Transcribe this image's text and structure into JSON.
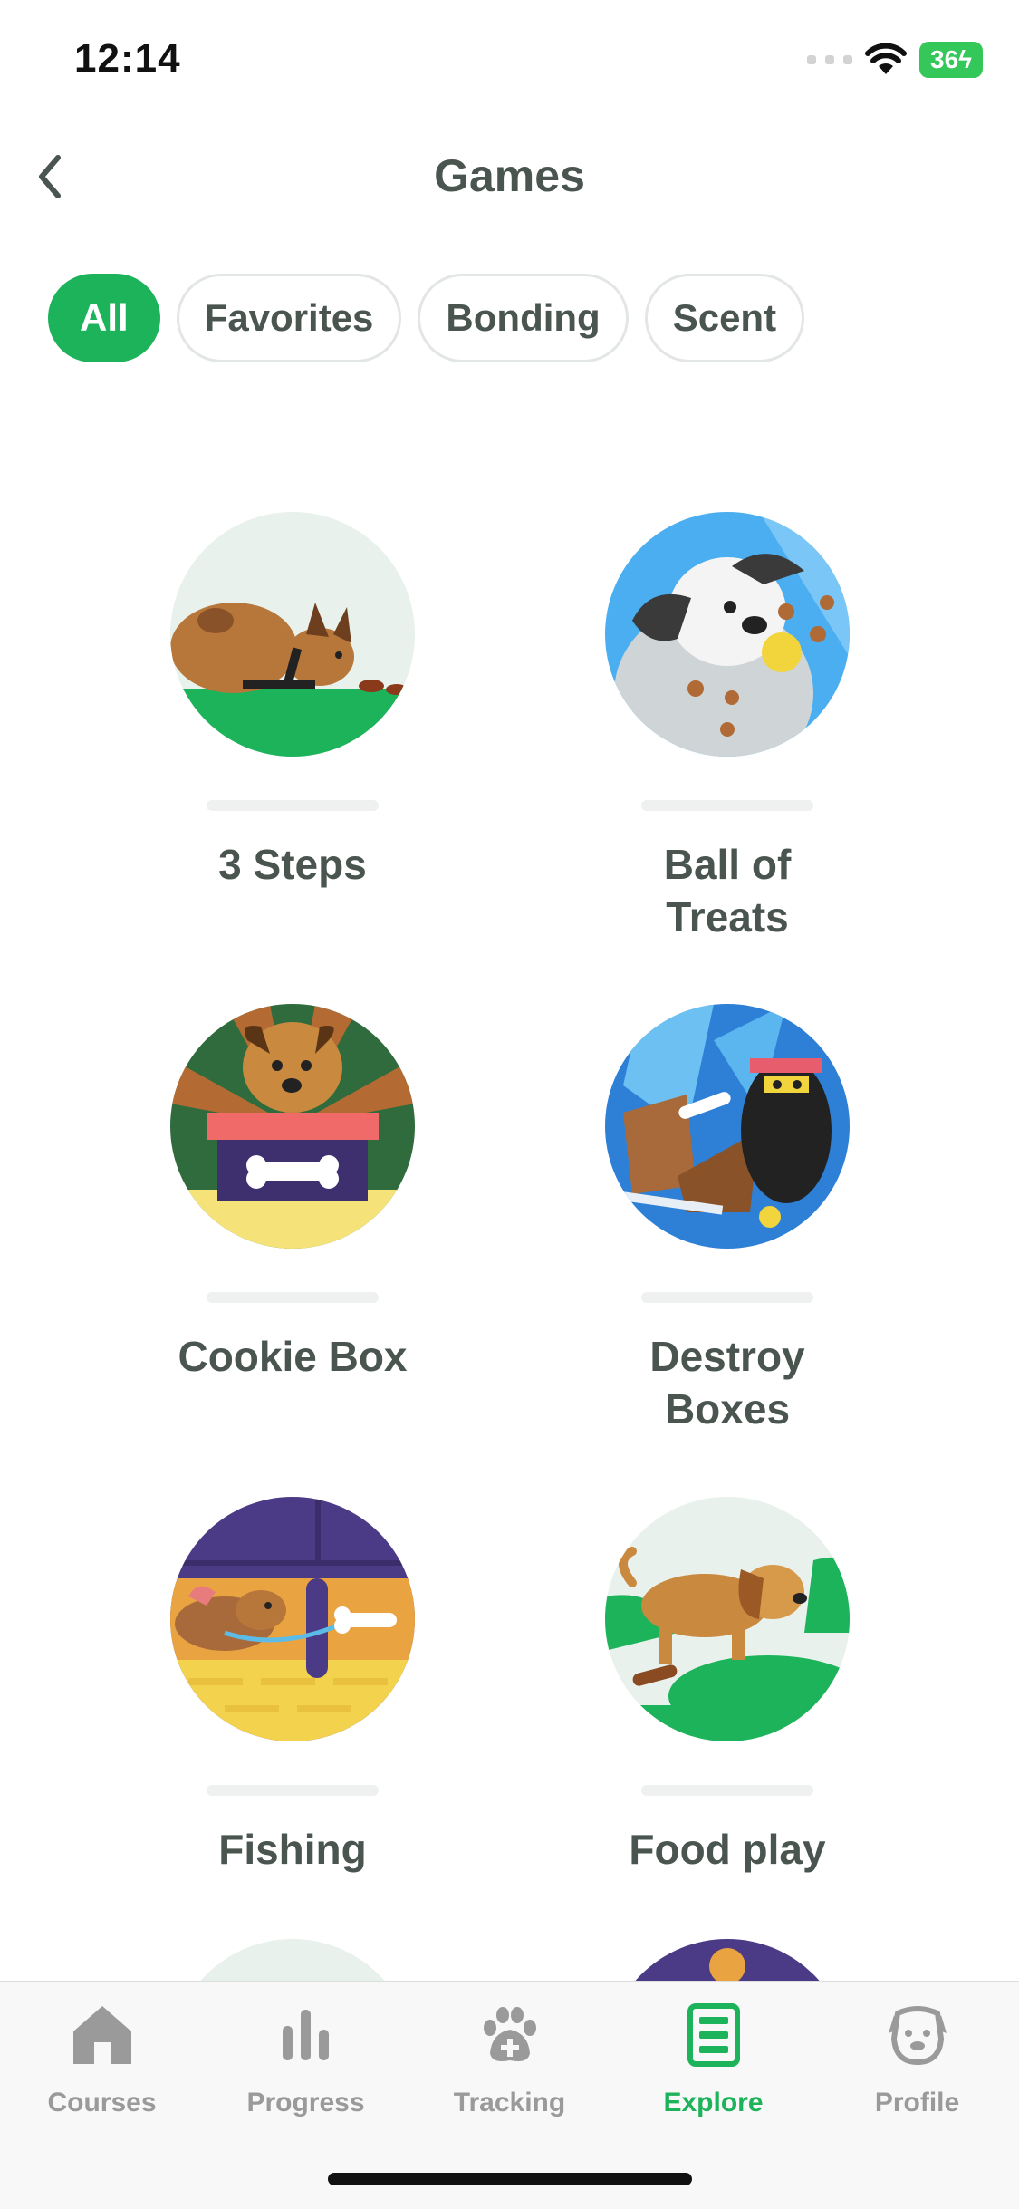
{
  "status": {
    "time": "12:14",
    "battery": "36"
  },
  "header": {
    "title": "Games"
  },
  "filters": [
    {
      "label": "All",
      "active": true
    },
    {
      "label": "Favorites",
      "active": false
    },
    {
      "label": "Bonding",
      "active": false
    },
    {
      "label": "Scent",
      "active": false
    }
  ],
  "games": [
    {
      "line1": "3 Steps",
      "line2": ""
    },
    {
      "line1": "Ball of",
      "line2": "Treats"
    },
    {
      "line1": "Cookie Box",
      "line2": ""
    },
    {
      "line1": "Destroy",
      "line2": "Boxes"
    },
    {
      "line1": "Fishing",
      "line2": ""
    },
    {
      "line1": "Food play",
      "line2": ""
    }
  ],
  "tabs": [
    {
      "label": "Courses",
      "icon": "home-icon"
    },
    {
      "label": "Progress",
      "icon": "bar-chart-icon"
    },
    {
      "label": "Tracking",
      "icon": "paw-plus-icon"
    },
    {
      "label": "Explore",
      "icon": "explore-list-icon"
    },
    {
      "label": "Profile",
      "icon": "dog-face-icon"
    }
  ],
  "colors": {
    "accent": "#1db35a",
    "text": "#4a5550",
    "inactive_tab": "#9a9a9a"
  }
}
